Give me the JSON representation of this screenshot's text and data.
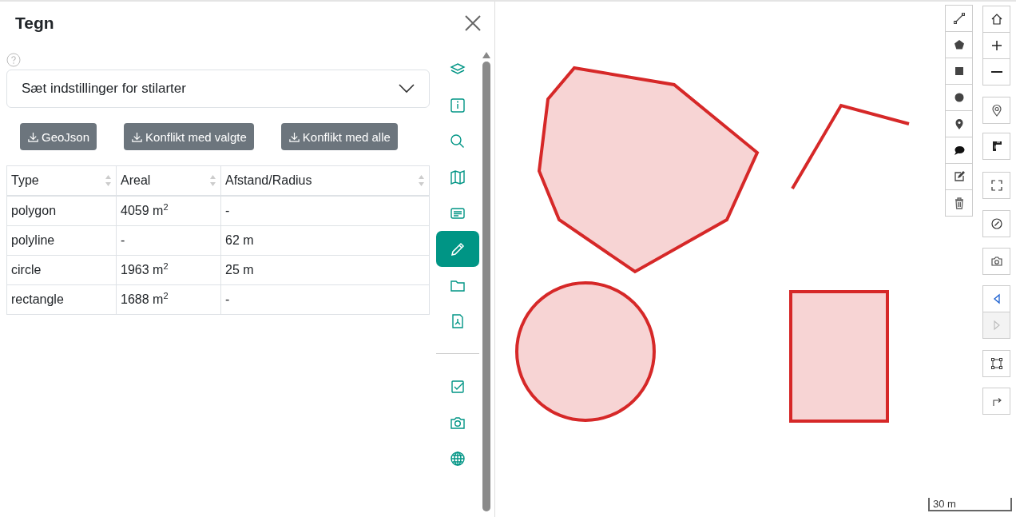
{
  "panel": {
    "title": "Tegn"
  },
  "style_dropdown": {
    "label": "Sæt indstillinger for stilarter"
  },
  "export_buttons": [
    "GeoJson",
    "Konflikt med valgte",
    "Konflikt med alle"
  ],
  "table": {
    "columns": [
      "Type",
      "Areal",
      "Afstand/Radius"
    ],
    "rows": [
      [
        "polygon",
        "4059 m$^{2}$",
        "-"
      ],
      [
        "polyline",
        "-",
        "62 m"
      ],
      [
        "circle",
        "1963 m$^{2}$",
        "25 m"
      ],
      [
        "rectangle",
        "1688 m$^{2}$",
        "-"
      ]
    ]
  },
  "side_nav": {
    "groups": [
      [
        {
          "selected": false
        },
        {
          "selected": false
        },
        {
          "selected": false
        },
        {
          "selected": false
        },
        {
          "selected": false
        },
        {
          "selected": true
        },
        {
          "selected": false
        },
        {
          "selected": false
        }
      ],
      [
        {
          "selected": false
        },
        {
          "selected": false
        },
        {
          "selected": false
        }
      ]
    ]
  },
  "map_controls": [
    {
      "disabled": false
    },
    {
      "disabled": false
    },
    {
      "disabled": false
    },
    {
      "disabled": false
    },
    {
      "disabled": false
    },
    {
      "disabled": false
    },
    {
      "disabled": false
    },
    {
      "disabled": false
    },
    {
      "disabled": false
    },
    {
      "disabled": true
    },
    {
      "disabled": false
    },
    {
      "disabled": false
    }
  ],
  "scale_bar": {
    "label": "30 m"
  }
}
